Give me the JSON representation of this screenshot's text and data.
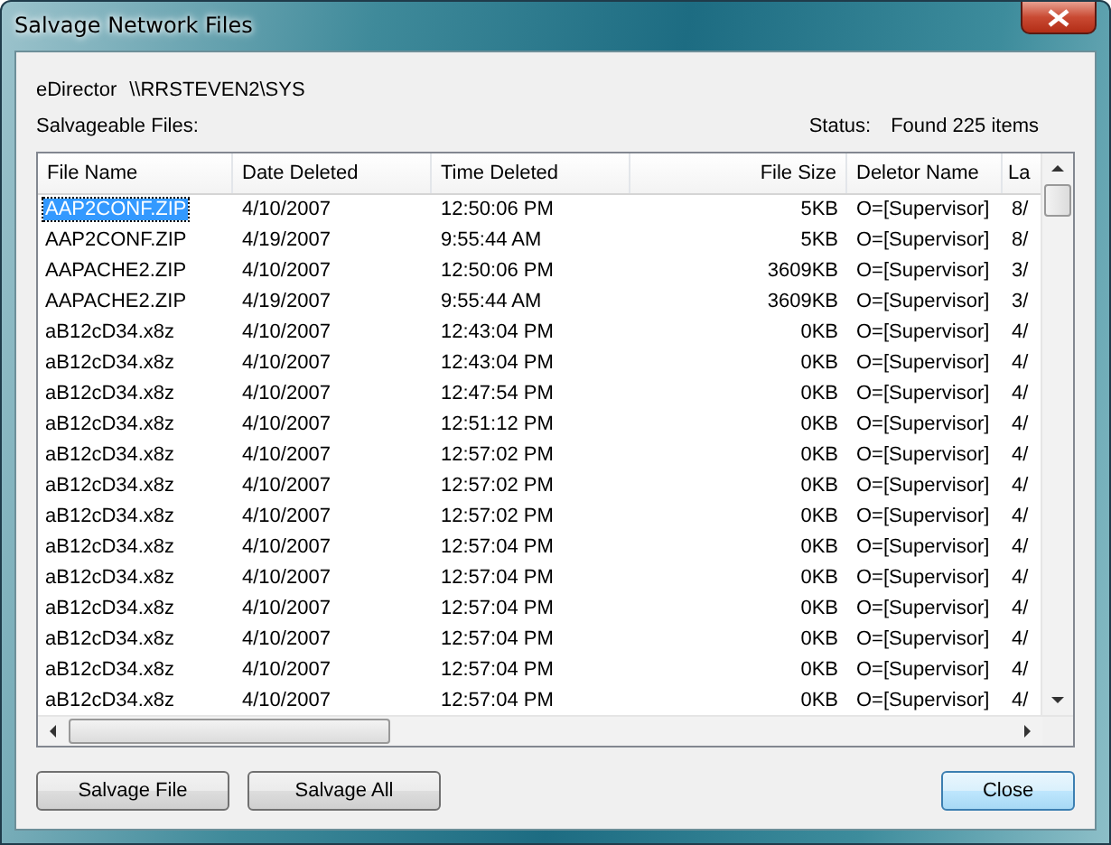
{
  "window": {
    "title": "Salvage Network Files"
  },
  "location": {
    "label": "eDirector",
    "path": "\\\\RRSTEVEN2\\SYS"
  },
  "list_label": {
    "text": "Salvageable Files:"
  },
  "status": {
    "label": "Status:",
    "value": "Found 225 items"
  },
  "table": {
    "columns": [
      "File Name",
      "Date Deleted",
      "Time Deleted",
      "File Size",
      "Deletor Name",
      "La"
    ],
    "rows": [
      {
        "selected": true,
        "cells": [
          "AAP2CONF.ZIP",
          "4/10/2007",
          "12:50:06 PM",
          "5KB",
          "O=[Supervisor]",
          "8/"
        ]
      },
      {
        "selected": false,
        "cells": [
          "AAP2CONF.ZIP",
          "4/19/2007",
          "9:55:44 AM",
          "5KB",
          "O=[Supervisor]",
          "8/"
        ]
      },
      {
        "selected": false,
        "cells": [
          "AAPACHE2.ZIP",
          "4/10/2007",
          "12:50:06 PM",
          "3609KB",
          "O=[Supervisor]",
          "3/"
        ]
      },
      {
        "selected": false,
        "cells": [
          "AAPACHE2.ZIP",
          "4/19/2007",
          "9:55:44 AM",
          "3609KB",
          "O=[Supervisor]",
          "3/"
        ]
      },
      {
        "selected": false,
        "cells": [
          "aB12cD34.x8z",
          "4/10/2007",
          "12:43:04 PM",
          "0KB",
          "O=[Supervisor]",
          "4/"
        ]
      },
      {
        "selected": false,
        "cells": [
          "aB12cD34.x8z",
          "4/10/2007",
          "12:43:04 PM",
          "0KB",
          "O=[Supervisor]",
          "4/"
        ]
      },
      {
        "selected": false,
        "cells": [
          "aB12cD34.x8z",
          "4/10/2007",
          "12:47:54 PM",
          "0KB",
          "O=[Supervisor]",
          "4/"
        ]
      },
      {
        "selected": false,
        "cells": [
          "aB12cD34.x8z",
          "4/10/2007",
          "12:51:12 PM",
          "0KB",
          "O=[Supervisor]",
          "4/"
        ]
      },
      {
        "selected": false,
        "cells": [
          "aB12cD34.x8z",
          "4/10/2007",
          "12:57:02 PM",
          "0KB",
          "O=[Supervisor]",
          "4/"
        ]
      },
      {
        "selected": false,
        "cells": [
          "aB12cD34.x8z",
          "4/10/2007",
          "12:57:02 PM",
          "0KB",
          "O=[Supervisor]",
          "4/"
        ]
      },
      {
        "selected": false,
        "cells": [
          "aB12cD34.x8z",
          "4/10/2007",
          "12:57:02 PM",
          "0KB",
          "O=[Supervisor]",
          "4/"
        ]
      },
      {
        "selected": false,
        "cells": [
          "aB12cD34.x8z",
          "4/10/2007",
          "12:57:04 PM",
          "0KB",
          "O=[Supervisor]",
          "4/"
        ]
      },
      {
        "selected": false,
        "cells": [
          "aB12cD34.x8z",
          "4/10/2007",
          "12:57:04 PM",
          "0KB",
          "O=[Supervisor]",
          "4/"
        ]
      },
      {
        "selected": false,
        "cells": [
          "aB12cD34.x8z",
          "4/10/2007",
          "12:57:04 PM",
          "0KB",
          "O=[Supervisor]",
          "4/"
        ]
      },
      {
        "selected": false,
        "cells": [
          "aB12cD34.x8z",
          "4/10/2007",
          "12:57:04 PM",
          "0KB",
          "O=[Supervisor]",
          "4/"
        ]
      },
      {
        "selected": false,
        "cells": [
          "aB12cD34.x8z",
          "4/10/2007",
          "12:57:04 PM",
          "0KB",
          "O=[Supervisor]",
          "4/"
        ]
      },
      {
        "selected": false,
        "cells": [
          "aB12cD34.x8z",
          "4/10/2007",
          "12:57:04 PM",
          "0KB",
          "O=[Supervisor]",
          "4/"
        ]
      }
    ]
  },
  "buttons": [
    {
      "label": "Salvage File",
      "default": false
    },
    {
      "label": "Salvage All",
      "default": false
    },
    {
      "label": "Close",
      "default": true
    }
  ]
}
